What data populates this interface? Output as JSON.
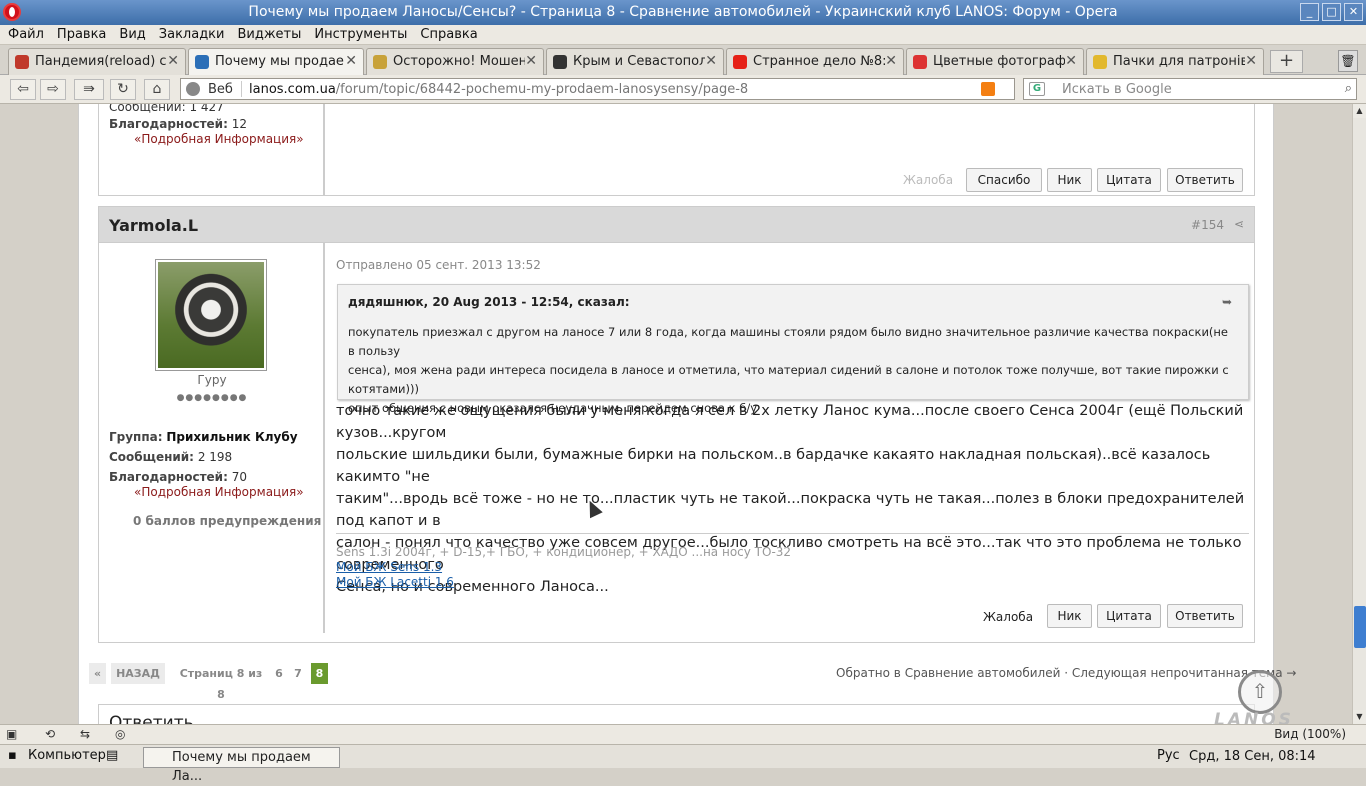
{
  "window": {
    "title": "Почему мы продаем Ланосы/Сенсы? - Страница 8 - Сравнение автомобилей - Украинский клуб LANOS: Форум - Opera",
    "buttons": [
      "_",
      "□",
      "✕"
    ]
  },
  "menu": [
    "Файл",
    "Правка",
    "Вид",
    "Закладки",
    "Виджеты",
    "Инструменты",
    "Справка"
  ],
  "tabs": [
    {
      "label": "Пандемия(reload) с...",
      "icon_color": "#c0392b",
      "active": false
    },
    {
      "label": "Почему мы продае...",
      "icon_color": "#2c6fb7",
      "active": true
    },
    {
      "label": "Осторожно! Мошен...",
      "icon_color": "#c8a23a",
      "active": false
    },
    {
      "label": "Крым и Севастопол...",
      "icon_color": "#333333",
      "active": false
    },
    {
      "label": "Странное дело №8:...",
      "icon_color": "#e62117",
      "active": false
    },
    {
      "label": "Цветные фотограф...",
      "icon_color": "#d33",
      "active": false
    },
    {
      "label": "Пачки для патронів...",
      "icon_color": "#e2b82d",
      "active": false
    }
  ],
  "address": {
    "label": "Веб",
    "host": "lanos.com.ua",
    "path": "/forum/topic/68442-pochemu-my-prodaem-lanosysensy/page-8",
    "search_placeholder": "Искать в Google"
  },
  "prev_post": {
    "messages_partial": "Сообщений: 1 427",
    "thanks_label": "Благодарностей:",
    "thanks_value": "12",
    "more_info": "«Подробная Информация»",
    "report": "Жалоба",
    "buttons": [
      "Спасибо",
      "Ник",
      "Цитата",
      "Ответить"
    ]
  },
  "post": {
    "author": "Yarmola.L",
    "number": "#154",
    "rank": "Гуру",
    "pips": "●●●●●●●●",
    "group_label": "Группа:",
    "group_value": "Прихильник Клубу",
    "messages_label": "Сообщений:",
    "messages_value": "2 198",
    "thanks_label": "Благодарностей:",
    "thanks_value": "70",
    "more_info": "«Подробная Информация»",
    "warnings": "0 баллов предупреждения",
    "sent": "Отправлено 05 сент. 2013 13:52",
    "quote_header": "дядяшнюк, 20 Aug 2013 - 12:54, сказал:",
    "quote_lines": [
      "покупатель приезжал с другом на ланосе 7 или 8 года, когда машины стояли рядом было видно значительное различие качества покраски(не в пользу",
      "сенса), моя жена ради интереса посидела в ланосе и отметила, что материал сидений в салоне и потолок тоже получше, вот такие пирожки с котятами)))",
      "опыт общения с новым оказался неудачным, перейдем снова к б/у"
    ],
    "body_lines": [
      "точно такие же ощущения были у меня когда я сел в 2х летку Ланос кума...после своего Сенса 2004г (ещё Польский кузов...кругом",
      "польские шильдики были, бумажные бирки на польском..в бардачке какаято накладная польская)..всё казалось какимто \"не",
      "таким\"...вродь всё тоже - но не то...пластик чуть не такой...покраска чуть не такая...полез в блоки предохранителей под капот и в",
      "салон - понял что качество уже совсем другое...было тоскливо смотреть на всё это...так что это проблема не только современного",
      "Сенса, но и современного Ланоса..."
    ],
    "signature": "Sens 1.3i 2004г, + D-15,+ ГБО, + кондиционер, + ХАДО ...на носу ТО-32",
    "sig_links": [
      "Мой БЖ Sens 1.3",
      "Мой БЖ Lacetti 1.6"
    ],
    "report": "Жалоба",
    "buttons": [
      "Ник",
      "Цитата",
      "Ответить"
    ]
  },
  "pager": {
    "prev_arrow": "«",
    "back": "НАЗАД",
    "info": "Страниц 8 из 8",
    "pages": [
      "6",
      "7"
    ],
    "current": "8"
  },
  "back_links": "Обратно в Сравнение автомобилей · Следующая непрочитанная тема →",
  "reply_heading": "Ответить",
  "logo_text": "LANOS",
  "statusbar": {
    "zoom": "Вид (100%)"
  },
  "taskbar": {
    "computer": "Компьютер",
    "task": "Почему мы продаем Ла...",
    "lang": "Рус",
    "clock": "Срд, 18 Сен, 08:14"
  }
}
